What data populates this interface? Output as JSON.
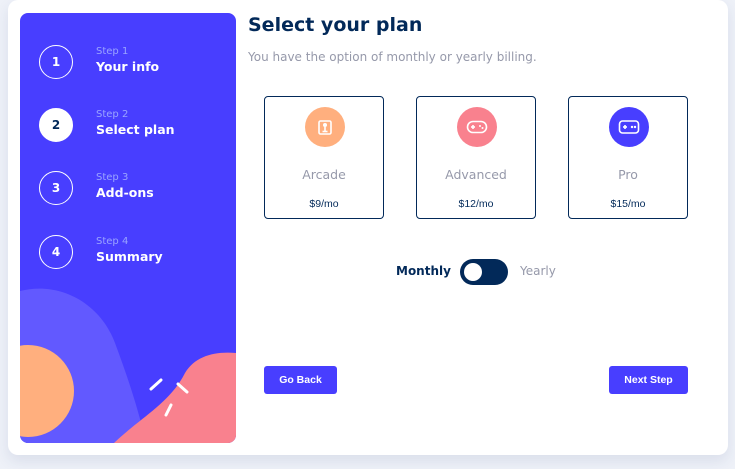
{
  "sidebar": {
    "steps": [
      {
        "number": "1",
        "caption": "Step 1",
        "title": "Your info",
        "active": false
      },
      {
        "number": "2",
        "caption": "Step 2",
        "title": "Select plan",
        "active": true
      },
      {
        "number": "3",
        "caption": "Step 3",
        "title": "Add-ons",
        "active": false
      },
      {
        "number": "4",
        "caption": "Step 4",
        "title": "Summary",
        "active": false
      }
    ]
  },
  "main": {
    "title": "Select your plan",
    "subtitle": "You have the option of monthly or yearly billing."
  },
  "plans": [
    {
      "name": "Arcade",
      "price": "$9/mo",
      "icon": "arcade-joystick-icon",
      "color": "#ffaf7e"
    },
    {
      "name": "Advanced",
      "price": "$12/mo",
      "icon": "gamepad-icon",
      "color": "#f9818e"
    },
    {
      "name": "Pro",
      "price": "$15/mo",
      "icon": "controller-icon",
      "color": "#483eff"
    }
  ],
  "billing": {
    "monthly_label": "Monthly",
    "yearly_label": "Yearly",
    "selected": "monthly"
  },
  "buttons": {
    "back_label": "Go Back",
    "next_label": "Next Step"
  },
  "colors": {
    "accent": "#483eff",
    "marine": "#022959",
    "grey": "#9699aa"
  }
}
